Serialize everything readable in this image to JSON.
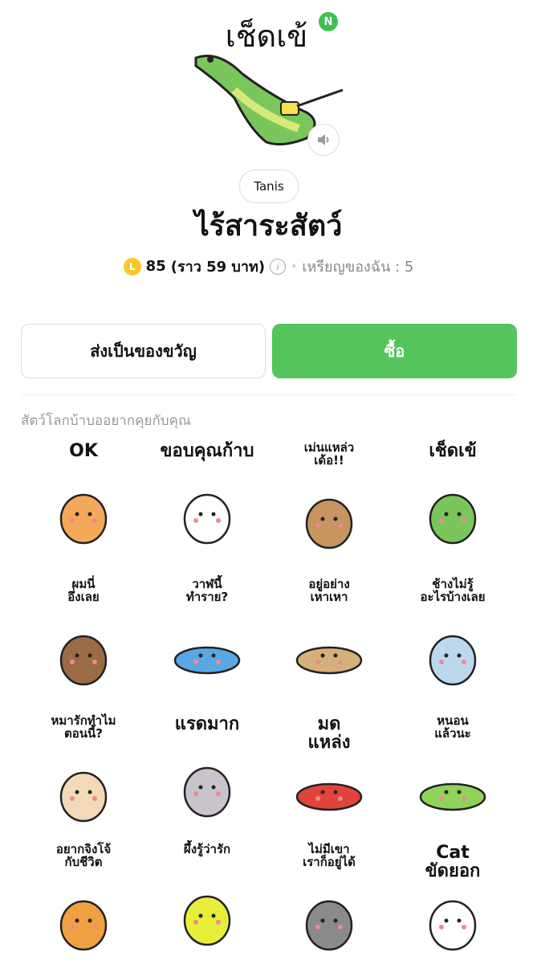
{
  "badge": "N",
  "creator": "Tanis",
  "title": "ไร้สาระสัตว์",
  "price": {
    "coin_icon_letter": "L",
    "amount": "85",
    "approx": "(ราว 59 บาท)",
    "my_coins": "เหรียญของฉัน : 5"
  },
  "buttons": {
    "gift": "ส่งเป็นของขวัญ",
    "buy": "ซื้อ"
  },
  "description": "สัตว์โลกบ้าบออยากคุยกับคุณ",
  "hero_text": "เช็ดเข้",
  "stickers": [
    {
      "text": "OK",
      "animal": "cat",
      "color": "#f3a85a"
    },
    {
      "text": "ขอบคุณก้าบ",
      "animal": "duck",
      "color": "#ffffff"
    },
    {
      "text": "เม่นแหล่ว\nเด้อ!!",
      "animal": "hedgehog",
      "color": "#c79560"
    },
    {
      "text": "เช็ดเข้",
      "animal": "crocodile",
      "color": "#7ac65c"
    },
    {
      "text": "ผมนี่\nอึ่งเลย",
      "animal": "toad",
      "color": "#9b6b45"
    },
    {
      "text": "วาฬนี้\nทำราย?",
      "animal": "whale",
      "color": "#5aa7e6"
    },
    {
      "text": "อยู่อย่าง\nเหาเหา",
      "animal": "louse",
      "color": "#d6b07a"
    },
    {
      "text": "ช้างไม่รู้\nอะไรบ้างเลย",
      "animal": "elephant",
      "color": "#bcd8ee"
    },
    {
      "text": "หมารักทำไม\nตอนนี้?",
      "animal": "dog",
      "color": "#f2d9b8"
    },
    {
      "text": "แรดมาก",
      "animal": "rhinos",
      "color": "#c8c3cc"
    },
    {
      "text": "มด\nแหล่ง",
      "animal": "ant",
      "color": "#e0443a"
    },
    {
      "text": "หนอน\nแล้วนะ",
      "animal": "worm",
      "color": "#8fd45a"
    },
    {
      "text": "อยากจิงโจ้\nกับชีวิต",
      "animal": "kangaroo",
      "color": "#f0a040"
    },
    {
      "text": "ผึ้งรู้ว่ารัก",
      "animal": "bee",
      "color": "#e6ee3a"
    },
    {
      "text": "ไม่มีเขา\nเราก็อยู่ได้",
      "animal": "buffalo",
      "color": "#8a8a8a"
    },
    {
      "text": "Cat\nขัดยอก",
      "animal": "cat2",
      "color": "#ffffff"
    }
  ]
}
